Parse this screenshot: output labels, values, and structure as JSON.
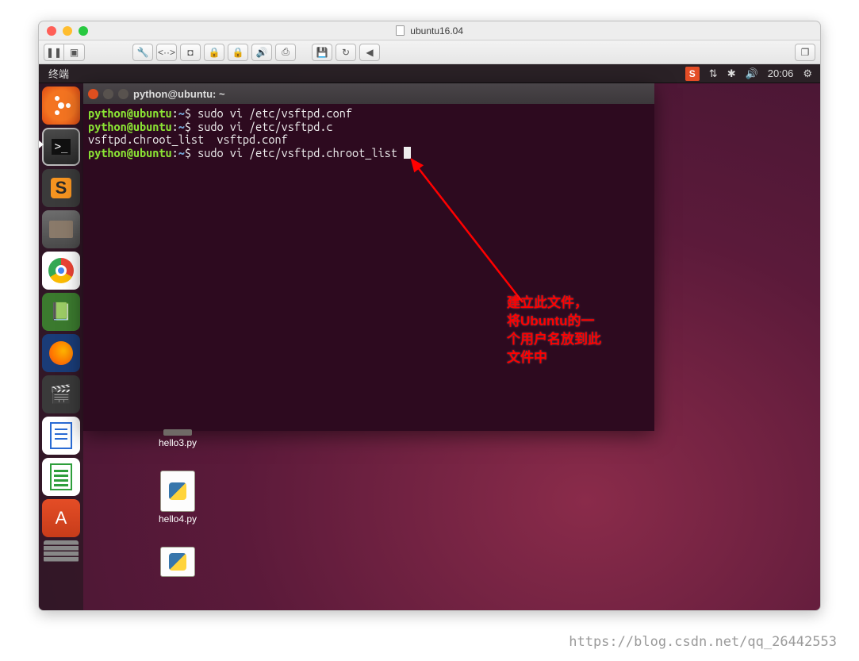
{
  "mac": {
    "title": "ubuntu16.04"
  },
  "toolbarIcons": {
    "pause": "❚❚",
    "snapshot": "▣",
    "wrench": "🔧",
    "net": "<··>",
    "disk": "◘",
    "lock1": "🔒",
    "lock2": "🔒",
    "sound": "🔊",
    "usb": "⎙",
    "floppy": "💾",
    "cycle": "↻",
    "back": "◀",
    "windows": "❐"
  },
  "ubuntu": {
    "menubarLabel": "终端",
    "time": "20:06",
    "sogou": "S",
    "indicators": {
      "updown": "⇅",
      "bluetooth": "✱",
      "volume": "🔊",
      "gear": "⚙"
    }
  },
  "terminal": {
    "title": "python@ubuntu: ~",
    "user": "python",
    "host": "ubuntu",
    "path": "~",
    "promptSep": "$",
    "lines": {
      "l1_cmd": "sudo vi /etc/vsftpd.conf",
      "l2_cmd": "sudo vi /etc/vsftpd.c",
      "l3": "vsftpd.chroot_list  vsftpd.conf",
      "l4_cmd": "sudo vi /etc/vsftpd.chroot_list "
    }
  },
  "desktop": {
    "file1": "hello3.py",
    "file2": "hello4.py"
  },
  "annotation": {
    "line1": "建立此文件，",
    "line2": "将Ubuntu的一",
    "line3": "个用户名放到此",
    "line4": "文件中"
  },
  "launcherNames": {
    "dash": "ubuntu-dash",
    "terminal": "terminal",
    "sublime": "sublime",
    "files": "files",
    "chrome": "chrome",
    "books": "books",
    "firefox": "firefox",
    "video": "video",
    "writer": "writer",
    "calc": "calc",
    "software": "software",
    "stack": "app-switcher"
  },
  "watermark": "https://blog.csdn.net/qq_26442553"
}
